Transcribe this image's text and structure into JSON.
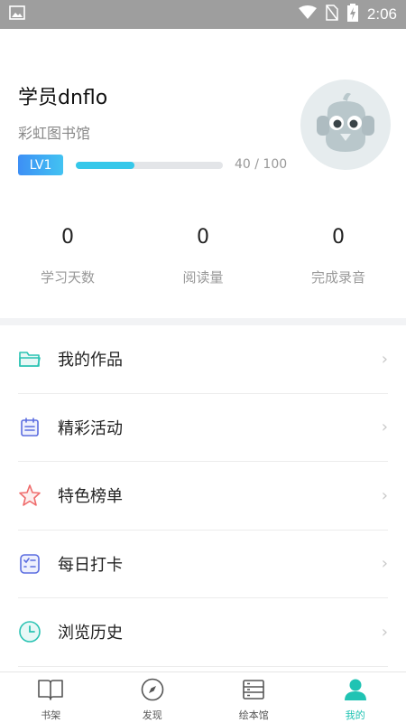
{
  "status_bar": {
    "time": "2:06"
  },
  "profile": {
    "username": "学员dnflo",
    "library_name": "彩虹图书馆",
    "level_badge": "LV1",
    "progress_text": "40 / 100",
    "progress_fraction": 0.4
  },
  "stats": [
    {
      "value": "0",
      "label": "学习天数"
    },
    {
      "value": "0",
      "label": "阅读量"
    },
    {
      "value": "0",
      "label": "完成录音"
    }
  ],
  "menu": [
    {
      "label": "我的作品",
      "icon": "folder-icon"
    },
    {
      "label": "精彩活动",
      "icon": "calendar-icon"
    },
    {
      "label": "特色榜单",
      "icon": "star-icon"
    },
    {
      "label": "每日打卡",
      "icon": "checklist-icon"
    },
    {
      "label": "浏览历史",
      "icon": "clock-icon"
    }
  ],
  "tabs": [
    {
      "label": "书架",
      "icon": "book-icon"
    },
    {
      "label": "发现",
      "icon": "compass-icon"
    },
    {
      "label": "绘本馆",
      "icon": "library-icon"
    },
    {
      "label": "我的",
      "icon": "user-icon",
      "active": true
    }
  ],
  "colors": {
    "accent": "#20c3b3",
    "progress": "#35c8ea",
    "badge": "#3d8ff5"
  }
}
